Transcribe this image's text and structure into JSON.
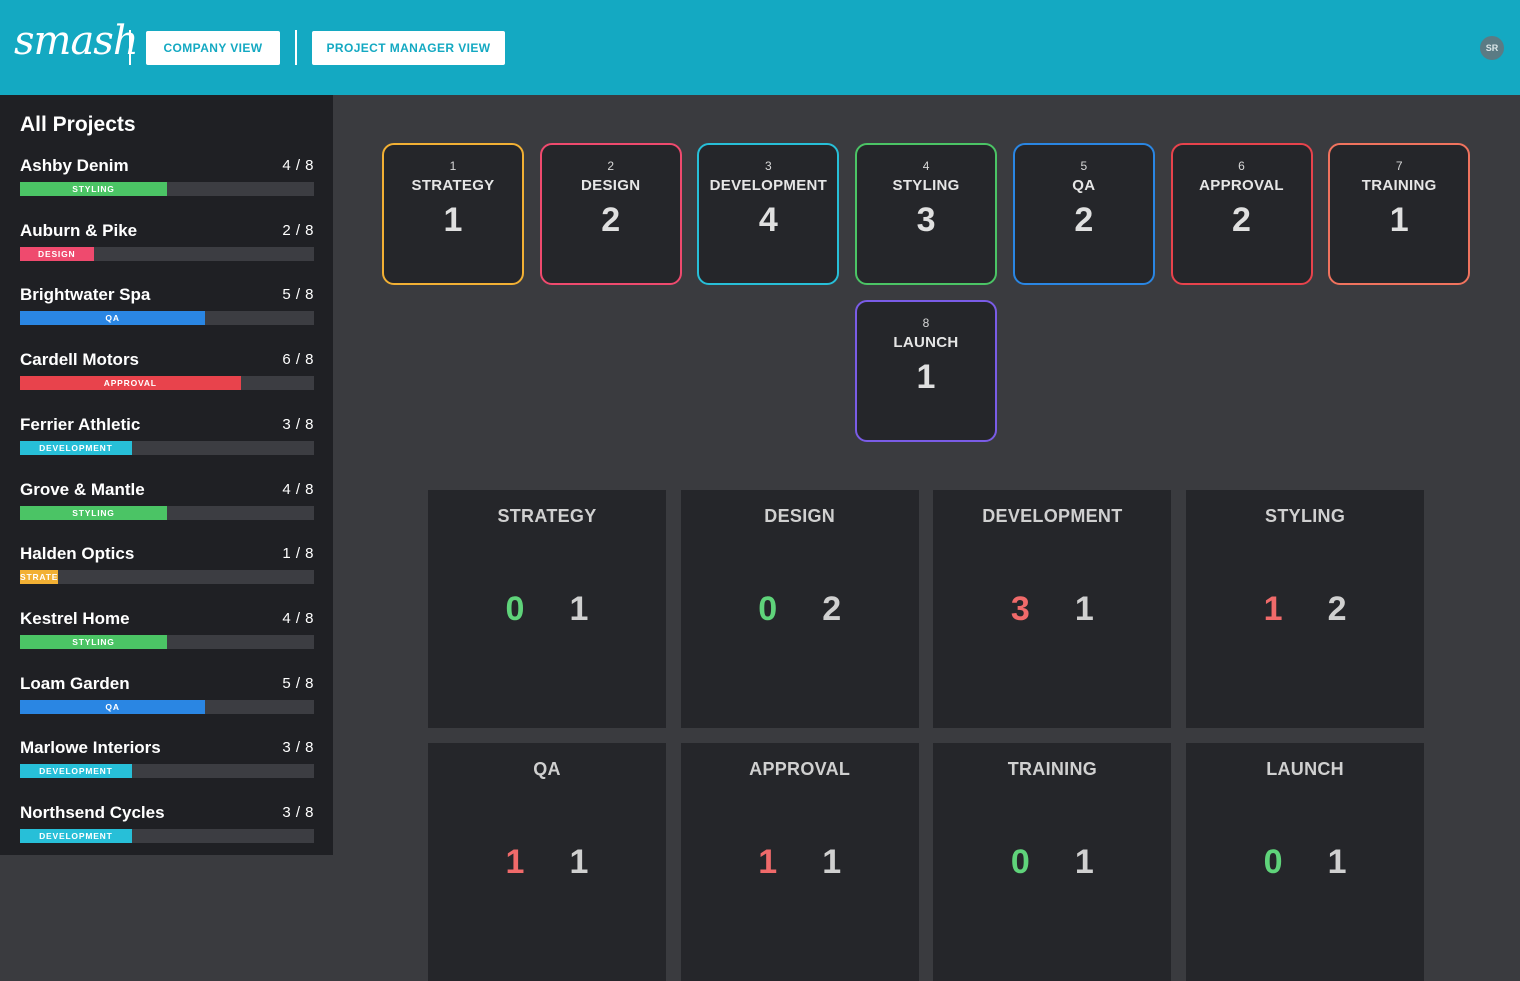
{
  "header": {
    "logo": "smash",
    "company_view": "COMPANY VIEW",
    "pm_view": "PROJECT MANAGER VIEW",
    "avatar": "SR"
  },
  "sidebar": {
    "title": "All Projects",
    "projects": [
      {
        "name": "Ashby Denim",
        "count": "4 / 8",
        "stage": "STYLING",
        "progress": 0.5,
        "color": "#4bc465"
      },
      {
        "name": "Auburn & Pike",
        "count": "2 / 8",
        "stage": "DESIGN",
        "progress": 0.25,
        "color": "#ef4a6e"
      },
      {
        "name": "Brightwater Spa",
        "count": "5 / 8",
        "stage": "QA",
        "progress": 0.63,
        "color": "#2a86e3"
      },
      {
        "name": "Cardell Motors",
        "count": "6 / 8",
        "stage": "APPROVAL",
        "progress": 0.75,
        "color": "#e8434c"
      },
      {
        "name": "Ferrier Athletic",
        "count": "3 / 8",
        "stage": "DEVELOPMENT",
        "progress": 0.38,
        "color": "#27bfd8"
      },
      {
        "name": "Grove & Mantle",
        "count": "4 / 8",
        "stage": "STYLING",
        "progress": 0.5,
        "color": "#4bc465"
      },
      {
        "name": "Halden Optics",
        "count": "1 / 8",
        "stage": "STRATEGY",
        "progress": 0.13,
        "color": "#f2b034"
      },
      {
        "name": "Kestrel Home",
        "count": "4 / 8",
        "stage": "STYLING",
        "progress": 0.5,
        "color": "#4bc465"
      },
      {
        "name": "Loam Garden",
        "count": "5 / 8",
        "stage": "QA",
        "progress": 0.63,
        "color": "#2a86e3"
      },
      {
        "name": "Marlowe Interiors",
        "count": "3 / 8",
        "stage": "DEVELOPMENT",
        "progress": 0.38,
        "color": "#27bfd8"
      },
      {
        "name": "Northsend Cycles",
        "count": "3 / 8",
        "stage": "DEVELOPMENT",
        "progress": 0.38,
        "color": "#27bfd8"
      }
    ]
  },
  "stages": [
    {
      "num": "1",
      "label": "STRATEGY",
      "count": "1",
      "color": "#f2b034"
    },
    {
      "num": "2",
      "label": "DESIGN",
      "count": "2",
      "color": "#ef4a6e"
    },
    {
      "num": "3",
      "label": "DEVELOPMENT",
      "count": "4",
      "color": "#27bfd8"
    },
    {
      "num": "4",
      "label": "STYLING",
      "count": "3",
      "color": "#4bc465"
    },
    {
      "num": "5",
      "label": "QA",
      "count": "2",
      "color": "#2a86e3"
    },
    {
      "num": "6",
      "label": "APPROVAL",
      "count": "2",
      "color": "#e8434c"
    },
    {
      "num": "7",
      "label": "TRAINING",
      "count": "1",
      "color": "#f0735e"
    },
    {
      "num": "8",
      "label": "LAUNCH",
      "count": "1",
      "color": "#7a5ce6"
    }
  ],
  "panels": [
    {
      "title": "STRATEGY",
      "a": "0",
      "b": "1",
      "a_color": "#5fd37a"
    },
    {
      "title": "DESIGN",
      "a": "0",
      "b": "2",
      "a_color": "#5fd37a"
    },
    {
      "title": "DEVELOPMENT",
      "a": "3",
      "b": "1",
      "a_color": "#f06a6a"
    },
    {
      "title": "STYLING",
      "a": "1",
      "b": "2",
      "a_color": "#f06a6a"
    },
    {
      "title": "QA",
      "a": "1",
      "b": "1",
      "a_color": "#f06a6a"
    },
    {
      "title": "APPROVAL",
      "a": "1",
      "b": "1",
      "a_color": "#f06a6a"
    },
    {
      "title": "TRAINING",
      "a": "0",
      "b": "1",
      "a_color": "#5fd37a"
    },
    {
      "title": "LAUNCH",
      "a": "0",
      "b": "1",
      "a_color": "#5fd37a"
    }
  ]
}
